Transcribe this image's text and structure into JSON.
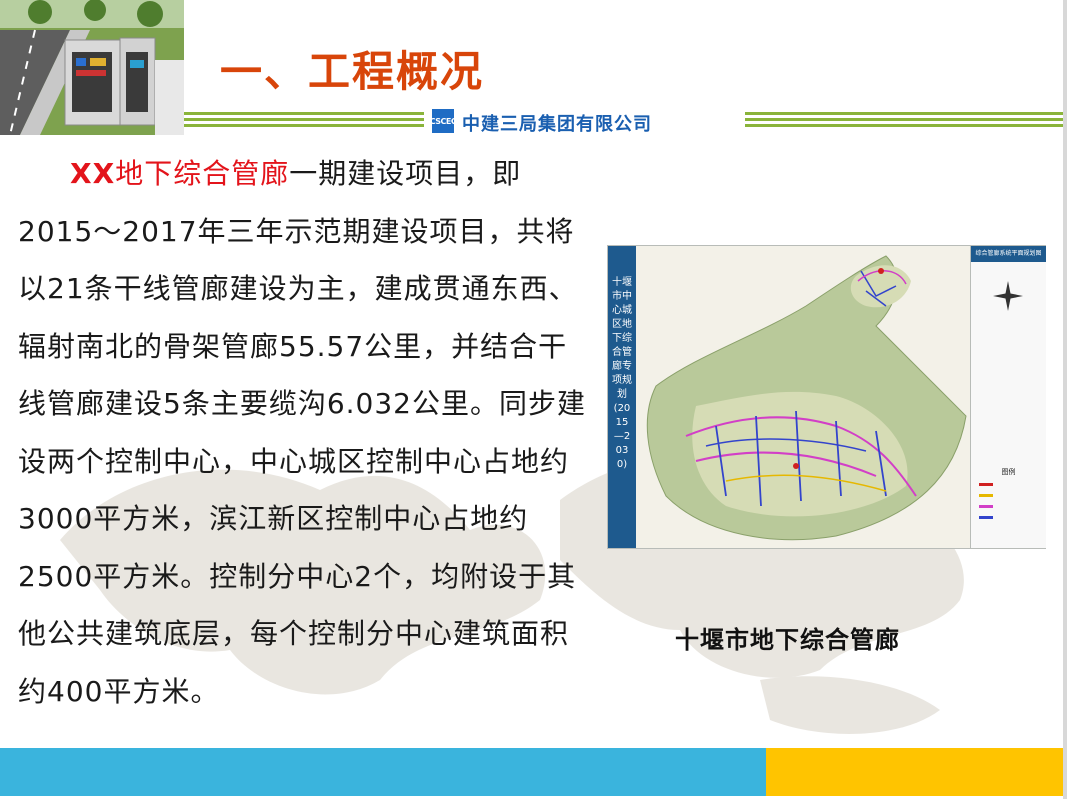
{
  "slide": {
    "title": "一、工程概况",
    "company": {
      "logo_text": "CSCEC",
      "name": "中建三局集团有限公司"
    },
    "body": {
      "highlight_bold": "XX",
      "highlight_rest": "地下综合管廊",
      "text": "一期建设项目，即2015～2017年三年示范期建设项目，共将以21条干线管廊建设为主，建成贯通东西、辐射南北的骨架管廊55.57公里，并结合干线管廊建设5条主要缆沟6.032公里。同步建设两个控制中心，中心城区控制中心占地约3000平方米，滨江新区控制中心占地约2500平方米。控制分中心2个，均附设于其他公共建筑底层，每个控制分中心建筑面积约400平方米。"
    },
    "map": {
      "side_title": "十堰市中心城区地下综合管廊专项规划(2015—2030)",
      "header_text": "综合管廊系统平面规划图",
      "legend_title": "图例"
    },
    "caption": "十堰市地下综合管廊"
  },
  "colors": {
    "title": "#d8450a",
    "highlight": "#e3141b",
    "company": "#1a5fb0",
    "stripe": "#8ab43a",
    "footer_blue": "#3ab4dd",
    "footer_yellow": "#ffc400"
  }
}
